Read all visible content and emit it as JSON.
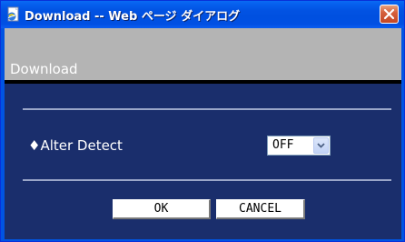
{
  "window": {
    "title": "Download -- Web ページ ダイアログ",
    "title_icon": "ie-page-icon",
    "close_icon": "close-icon"
  },
  "header": {
    "title": "Download"
  },
  "setting": {
    "label": "♦Alter Detect",
    "select": {
      "value": "OFF",
      "arrow_icon": "chevron-down-icon"
    }
  },
  "buttons": {
    "ok_label": "OK",
    "cancel_label": "CANCEL"
  },
  "colors": {
    "titlebar": "#0054e3",
    "content_background": "#1a2e6c",
    "header_bar": "#b4b4b4",
    "divider": "#9aa6c8",
    "close_button": "#d5603d"
  }
}
